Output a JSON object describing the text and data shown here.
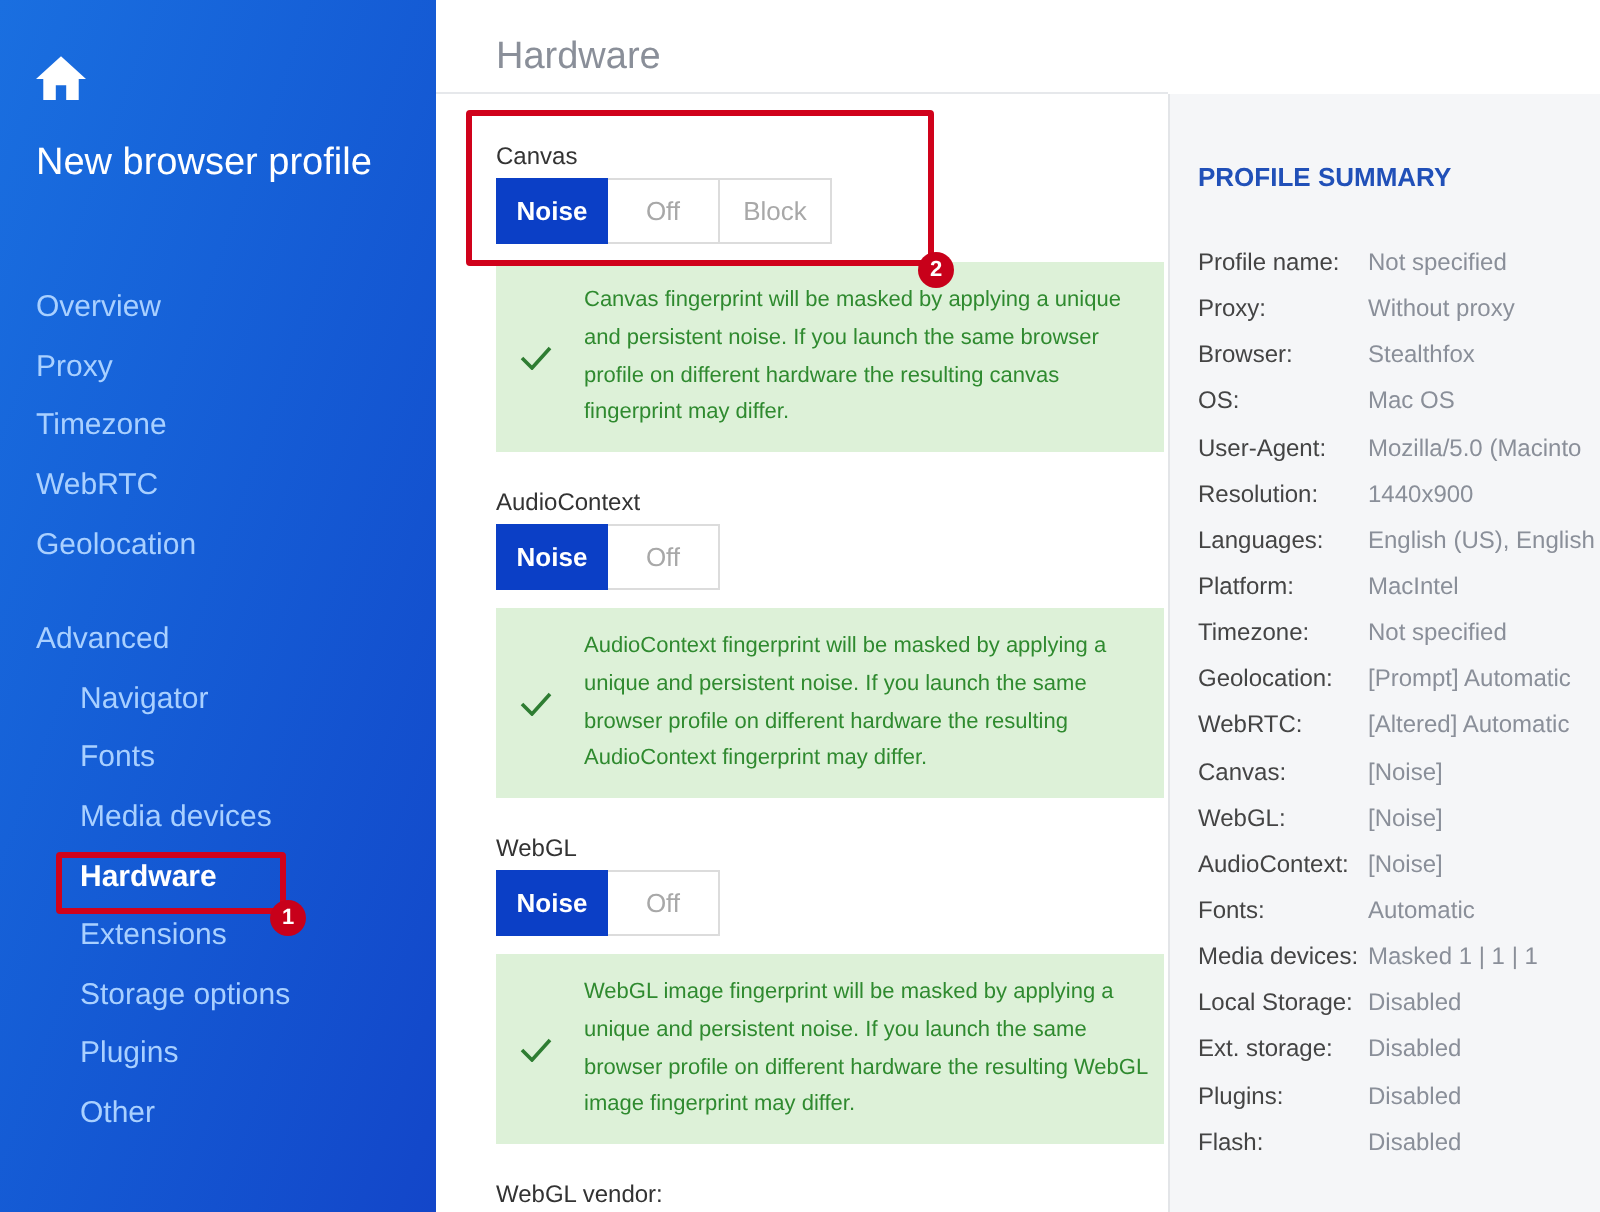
{
  "sidebar": {
    "title": "New browser profile",
    "items": [
      {
        "label": "Overview",
        "selected": false
      },
      {
        "label": "Proxy",
        "selected": false
      },
      {
        "label": "Timezone",
        "selected": false
      },
      {
        "label": "WebRTC",
        "selected": false
      },
      {
        "label": "Geolocation",
        "selected": false
      },
      {
        "label": "Advanced",
        "selected": false,
        "children": [
          {
            "label": "Navigator",
            "selected": false
          },
          {
            "label": "Fonts",
            "selected": false
          },
          {
            "label": "Media devices",
            "selected": false
          },
          {
            "label": "Hardware",
            "selected": true
          },
          {
            "label": "Extensions",
            "selected": false
          },
          {
            "label": "Storage options",
            "selected": false
          },
          {
            "label": "Plugins",
            "selected": false
          },
          {
            "label": "Other",
            "selected": false
          }
        ]
      }
    ]
  },
  "page_title": "Hardware",
  "sections": [
    {
      "label": "Canvas",
      "options": [
        {
          "label": "Noise",
          "selected": true
        },
        {
          "label": "Off",
          "selected": false
        },
        {
          "label": "Block",
          "selected": false
        }
      ],
      "note": "Canvas fingerprint will be masked by applying a unique and persistent noise. If you launch the same browser profile on different hardware the resulting canvas fingerprint may differ."
    },
    {
      "label": "AudioContext",
      "options": [
        {
          "label": "Noise",
          "selected": true
        },
        {
          "label": "Off",
          "selected": false
        }
      ],
      "note": "AudioContext fingerprint will be masked by applying a unique and persistent noise. If you launch the same browser profile on different hardware the resulting AudioContext fingerprint may differ."
    },
    {
      "label": "WebGL",
      "options": [
        {
          "label": "Noise",
          "selected": true
        },
        {
          "label": "Off",
          "selected": false
        }
      ],
      "note": "WebGL image fingerprint will be masked by applying a unique and persistent noise. If you launch the same browser profile on different hardware the resulting WebGL image fingerprint may differ."
    },
    {
      "label": "WebGL vendor:"
    }
  ],
  "summary": {
    "title": "PROFILE SUMMARY",
    "rows": [
      {
        "label": "Profile name:",
        "value": "Not specified"
      },
      {
        "label": "Proxy:",
        "value": "Without proxy"
      },
      {
        "label": "Browser:",
        "value": "Stealthfox"
      },
      {
        "label": "OS:",
        "value": "Mac OS"
      },
      {
        "label": "User-Agent:",
        "value": "Mozilla/5.0 (Macinto"
      },
      {
        "label": "Resolution:",
        "value": "1440x900"
      },
      {
        "label": "Languages:",
        "value": "English (US), English"
      },
      {
        "label": "Platform:",
        "value": "MacIntel"
      },
      {
        "label": "Timezone:",
        "value": "Not specified"
      },
      {
        "label": "Geolocation:",
        "value": "[Prompt] Automatic"
      },
      {
        "label": "WebRTC:",
        "value": "[Altered] Automatic"
      },
      {
        "label": "Canvas:",
        "value": "[Noise]"
      },
      {
        "label": "WebGL:",
        "value": "[Noise]"
      },
      {
        "label": "AudioContext:",
        "value": "[Noise]"
      },
      {
        "label": "Fonts:",
        "value": "Automatic"
      },
      {
        "label": "Media devices:",
        "value": "Masked 1 | 1 | 1"
      },
      {
        "label": "Local Storage:",
        "value": "Disabled"
      },
      {
        "label": "Ext. storage:",
        "value": "Disabled"
      },
      {
        "label": "Plugins:",
        "value": "Disabled"
      },
      {
        "label": "Flash:",
        "value": "Disabled"
      }
    ]
  },
  "annotations": [
    {
      "label": "1"
    },
    {
      "label": "2"
    }
  ]
}
